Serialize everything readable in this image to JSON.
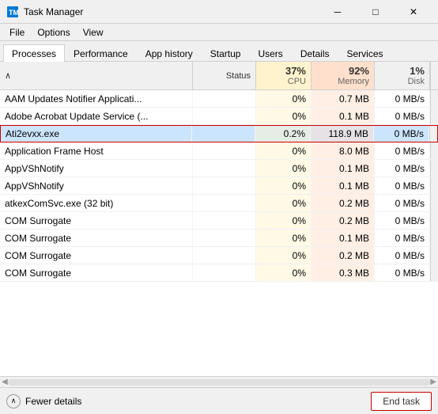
{
  "titleBar": {
    "title": "Task Manager",
    "minimizeLabel": "─",
    "maximizeLabel": "□",
    "closeLabel": "✕"
  },
  "menuBar": {
    "items": [
      "File",
      "Options",
      "View"
    ]
  },
  "tabs": [
    {
      "label": "Processes",
      "active": true
    },
    {
      "label": "Performance",
      "active": false
    },
    {
      "label": "App history",
      "active": false
    },
    {
      "label": "Startup",
      "active": false
    },
    {
      "label": "Users",
      "active": false
    },
    {
      "label": "Details",
      "active": false
    },
    {
      "label": "Services",
      "active": false
    }
  ],
  "tableHeader": {
    "sortArrow": "∧",
    "statusLabel": "Status",
    "cpuPercent": "37%",
    "cpuLabel": "CPU",
    "memoryPercent": "92%",
    "memoryLabel": "Memory",
    "diskPercent": "1%",
    "diskLabel": "Disk"
  },
  "rows": [
    {
      "name": "AAM Updates Notifier Applicati...",
      "status": "",
      "cpu": "0%",
      "memory": "0.7 MB",
      "disk": "0 MB/s",
      "selected": false
    },
    {
      "name": "Adobe Acrobat Update Service (...",
      "status": "",
      "cpu": "0%",
      "memory": "0.1 MB",
      "disk": "0 MB/s",
      "selected": false
    },
    {
      "name": "Ati2evxx.exe",
      "status": "",
      "cpu": "0.2%",
      "memory": "118.9 MB",
      "disk": "0 MB/s",
      "selected": true
    },
    {
      "name": "Application Frame Host",
      "status": "",
      "cpu": "0%",
      "memory": "8.0 MB",
      "disk": "0 MB/s",
      "selected": false
    },
    {
      "name": "AppVShNotify",
      "status": "",
      "cpu": "0%",
      "memory": "0.1 MB",
      "disk": "0 MB/s",
      "selected": false
    },
    {
      "name": "AppVShNotify",
      "status": "",
      "cpu": "0%",
      "memory": "0.1 MB",
      "disk": "0 MB/s",
      "selected": false
    },
    {
      "name": "atkexComSvc.exe (32 bit)",
      "status": "",
      "cpu": "0%",
      "memory": "0.2 MB",
      "disk": "0 MB/s",
      "selected": false
    },
    {
      "name": "COM Surrogate",
      "status": "",
      "cpu": "0%",
      "memory": "0.2 MB",
      "disk": "0 MB/s",
      "selected": false
    },
    {
      "name": "COM Surrogate",
      "status": "",
      "cpu": "0%",
      "memory": "0.1 MB",
      "disk": "0 MB/s",
      "selected": false
    },
    {
      "name": "COM Surrogate",
      "status": "",
      "cpu": "0%",
      "memory": "0.2 MB",
      "disk": "0 MB/s",
      "selected": false
    },
    {
      "name": "COM Surrogate",
      "status": "",
      "cpu": "0%",
      "memory": "0.3 MB",
      "disk": "0 MB/s",
      "selected": false
    }
  ],
  "bottomBar": {
    "fewerDetailsLabel": "Fewer details",
    "endTaskLabel": "End task"
  }
}
